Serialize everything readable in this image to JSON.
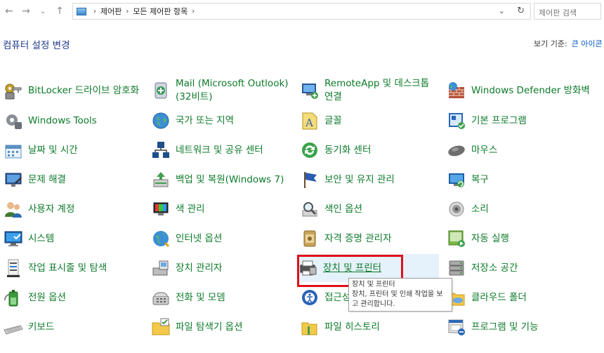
{
  "address": {
    "crumbs": [
      "제어판",
      "모든 제어판 항목"
    ],
    "search_placeholder": "제어판 검색"
  },
  "header": {
    "title": "컴퓨터 설정 변경",
    "view_by_label": "보기 기준:",
    "view_by_value": "큰 아이콘"
  },
  "columns": [
    [
      {
        "label": "BitLocker 드라이브 암호화",
        "icon": "bitlocker-icon"
      },
      {
        "label": "Windows Tools",
        "icon": "windows-tools-icon"
      },
      {
        "label": "날짜 및 시간",
        "icon": "date-time-icon"
      },
      {
        "label": "문제 해결",
        "icon": "troubleshooting-icon"
      },
      {
        "label": "사용자 계정",
        "icon": "user-accounts-icon"
      },
      {
        "label": "시스템",
        "icon": "system-icon"
      },
      {
        "label": "작업 표시줄 및 탐색",
        "icon": "taskbar-icon"
      },
      {
        "label": "전원 옵션",
        "icon": "power-options-icon"
      },
      {
        "label": "키보드",
        "icon": "keyboard-icon"
      }
    ],
    [
      {
        "label": "Mail (Microsoft Outlook)(32비트)",
        "icon": "mail-icon"
      },
      {
        "label": "국가 또는 지역",
        "icon": "region-icon"
      },
      {
        "label": "네트워크 및 공유 센터",
        "icon": "network-icon"
      },
      {
        "label": "백업 및 복원(Windows 7)",
        "icon": "backup-icon"
      },
      {
        "label": "색 관리",
        "icon": "color-management-icon"
      },
      {
        "label": "인터넷 옵션",
        "icon": "internet-options-icon"
      },
      {
        "label": "장치 관리자",
        "icon": "device-manager-icon"
      },
      {
        "label": "전화 및 모뎀",
        "icon": "phone-modem-icon"
      },
      {
        "label": "파일 탐색기 옵션",
        "icon": "folder-options-icon"
      }
    ],
    [
      {
        "label": "RemoteApp 및 데스크톱 연결",
        "icon": "remoteapp-icon"
      },
      {
        "label": "글꼴",
        "icon": "fonts-icon"
      },
      {
        "label": "동기화 센터",
        "icon": "sync-center-icon"
      },
      {
        "label": "보안 및 유지 관리",
        "icon": "security-maintenance-icon"
      },
      {
        "label": "색인 옵션",
        "icon": "indexing-icon"
      },
      {
        "label": "자격 증명 관리자",
        "icon": "credential-manager-icon"
      },
      {
        "label": "장치 및 프린터",
        "icon": "devices-printers-icon"
      },
      {
        "label": "접근성 센터",
        "icon": "ease-of-access-icon"
      },
      {
        "label": "파일 히스토리",
        "icon": "file-history-icon"
      }
    ],
    [
      {
        "label": "Windows Defender 방화벽",
        "icon": "firewall-icon"
      },
      {
        "label": "기본 프로그램",
        "icon": "default-programs-icon"
      },
      {
        "label": "마우스",
        "icon": "mouse-icon"
      },
      {
        "label": "복구",
        "icon": "recovery-icon"
      },
      {
        "label": "소리",
        "icon": "sound-icon"
      },
      {
        "label": "자동 실행",
        "icon": "autoplay-icon"
      },
      {
        "label": "저장소 공간",
        "icon": "storage-spaces-icon"
      },
      {
        "label": "클라우드 폴더",
        "icon": "cloud-folders-icon"
      },
      {
        "label": "프로그램 및 기능",
        "icon": "programs-features-icon"
      }
    ]
  ],
  "tooltip": {
    "title": "장치 및 프린터",
    "description": "장치, 프린터 및 인쇄 작업을 보고 관리합니다."
  },
  "colors": {
    "link_green": "#0d7a2a",
    "title_blue": "#1e3a8a",
    "highlight_red": "#e0101a",
    "selected_bg": "#e5f1fb"
  }
}
